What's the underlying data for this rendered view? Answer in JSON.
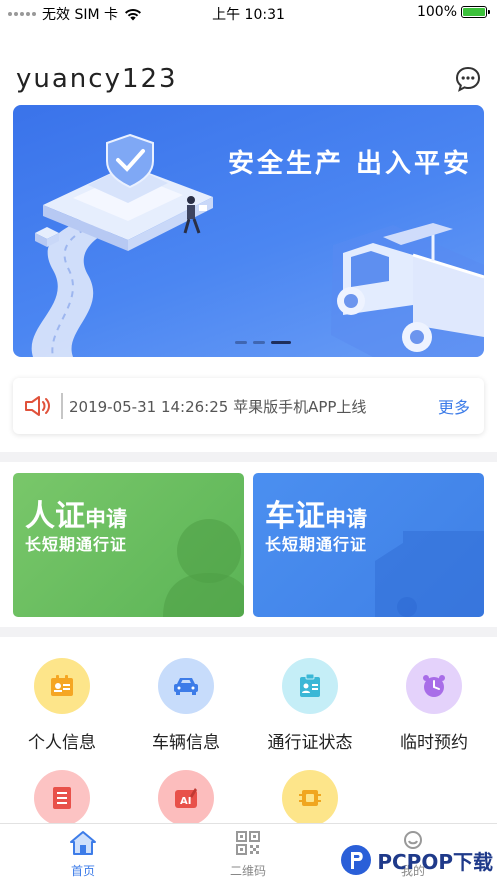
{
  "status_bar": {
    "carrier": "无效 SIM 卡",
    "time": "上午 10:31",
    "battery": "100%"
  },
  "header": {
    "username": "yuancy123",
    "message_icon": "chat-bubble-icon"
  },
  "banner": {
    "slogan": "安全生产 出入平安",
    "page_count": 3,
    "active_page": 3
  },
  "notice": {
    "icon": "speaker-icon",
    "text": "2019-05-31 14:26:25 苹果版手机APP上线",
    "more_label": "更多"
  },
  "cards": {
    "person": {
      "title_big": "人证",
      "title_small": "申请",
      "subtitle": "长短期通行证",
      "color": "#6bbd5e"
    },
    "vehicle": {
      "title_big": "车证",
      "title_small": "申请",
      "subtitle": "长短期通行证",
      "color": "#4588ec"
    }
  },
  "grid": {
    "items": [
      {
        "label": "个人信息",
        "icon": "id-card-icon",
        "color": "#fde58a"
      },
      {
        "label": "车辆信息",
        "icon": "car-icon",
        "color": "#c7dcfb"
      },
      {
        "label": "通行证状态",
        "icon": "badge-icon",
        "color": "#c5eef7"
      },
      {
        "label": "临时预约",
        "icon": "clock-icon",
        "color": "#e4d2fb"
      },
      {
        "label": "",
        "icon": "document-icon",
        "color": "#fcc3c3"
      },
      {
        "label": "",
        "icon": "ai-icon",
        "color": "#fcbdbd"
      },
      {
        "label": "",
        "icon": "chip-icon",
        "color": "#fde58a"
      }
    ]
  },
  "tabbar": {
    "tabs": [
      {
        "label": "首页",
        "icon": "home-icon",
        "active": true
      },
      {
        "label": "二维码",
        "icon": "qr-code-icon",
        "active": false
      },
      {
        "label": "我的",
        "icon": "user-icon",
        "active": false
      }
    ]
  },
  "watermark": {
    "text": "PCPOP下载"
  }
}
